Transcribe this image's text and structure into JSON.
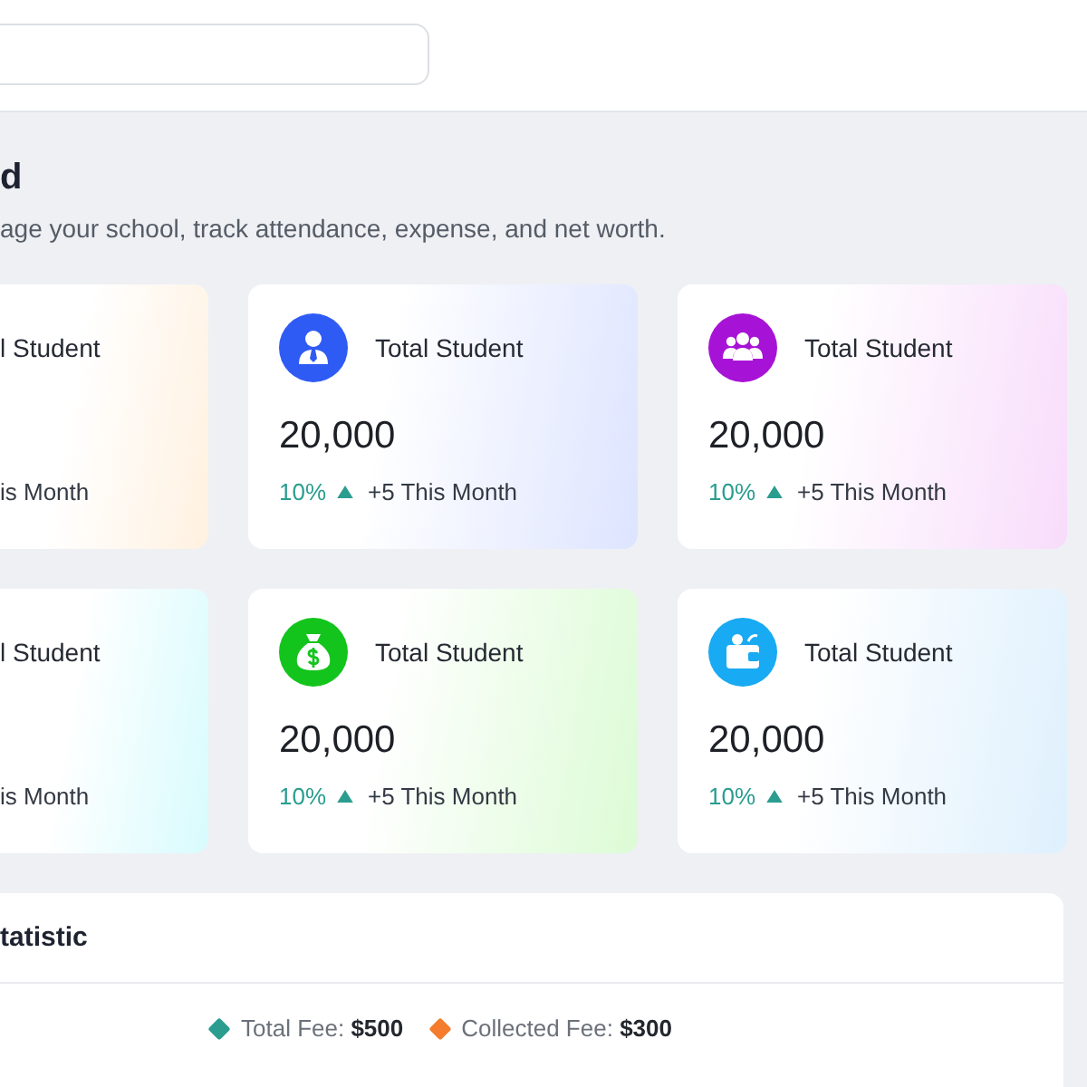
{
  "header": {
    "title": "d",
    "subtitle": "age your school, track attendance, expense, and net worth."
  },
  "cards": [
    {
      "title": "l Student",
      "period": "is Month"
    },
    {
      "kind": "person",
      "color": "#2f5bf5",
      "title": "Total Student",
      "value": "20,000",
      "change": "10%",
      "period": "+5 This Month"
    },
    {
      "kind": "group",
      "color": "#a713d6",
      "title": "Total Student",
      "value": "20,000",
      "change": "10%",
      "period": "+5 This Month"
    },
    {
      "title": "l Student",
      "period": "is Month"
    },
    {
      "kind": "money",
      "color": "#13c41d",
      "title": "Total Student",
      "value": "20,000",
      "change": "10%",
      "period": "+5 This Month"
    },
    {
      "kind": "wallet",
      "color": "#18aaf2",
      "title": "Total Student",
      "value": "20,000",
      "change": "10%",
      "period": "+5 This Month"
    }
  ],
  "statistics": {
    "title": "tatistic",
    "legend": [
      {
        "label": "Total Fee:",
        "value": "$500",
        "color": "#2a9d8f"
      },
      {
        "label": "Collected Fee:",
        "value": "$300",
        "color": "#f47c2c"
      }
    ]
  }
}
